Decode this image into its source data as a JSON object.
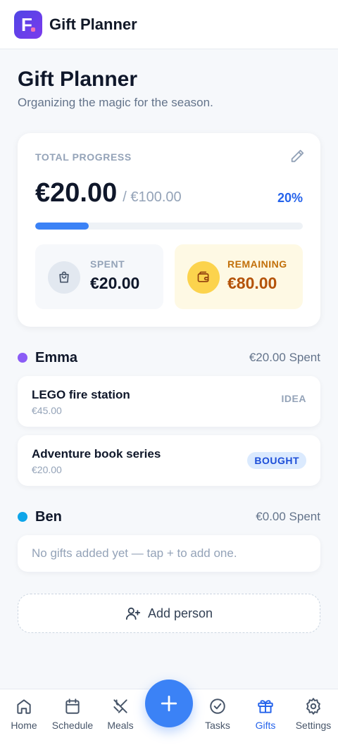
{
  "app": {
    "name": "Gift Planner",
    "logo_letter": "F"
  },
  "header": {
    "title": "Gift Planner",
    "subtitle": "Organizing the magic for the season."
  },
  "progress": {
    "label": "TOTAL PROGRESS",
    "spent": "€20.00",
    "total": "/ €100.00",
    "percent_label": "20%",
    "fraction": 0.2,
    "spent_label": "SPENT",
    "spent_value": "€20.00",
    "remaining_label": "REMAINING",
    "remaining_value": "€80.00"
  },
  "people": [
    {
      "name": "Emma",
      "spent": "€20.00 Spent",
      "color": "#8b5cf6",
      "gifts": [
        {
          "name": "LEGO fire station",
          "price": "€45.00",
          "status": "IDEA"
        },
        {
          "name": "Adventure book series",
          "price": "€20.00",
          "status": "BOUGHT"
        }
      ]
    },
    {
      "name": "Ben",
      "spent": "€0.00 Spent",
      "color": "#0ea5e9",
      "empty_text": "No gifts added yet — tap + to add one."
    }
  ],
  "add_person_label": "Add person",
  "nav": {
    "items": [
      {
        "label": "Home",
        "icon": "home-icon"
      },
      {
        "label": "Schedule",
        "icon": "calendar-icon"
      },
      {
        "label": "Meals",
        "icon": "utensils-icon"
      },
      {
        "label": "Tasks",
        "icon": "check-circle-icon"
      },
      {
        "label": "Gifts",
        "icon": "gift-icon",
        "active": true
      },
      {
        "label": "Settings",
        "icon": "gear-icon"
      }
    ],
    "fab_icon": "plus-icon"
  },
  "colors": {
    "accent": "#3b82f6",
    "warning": "#b45309"
  }
}
